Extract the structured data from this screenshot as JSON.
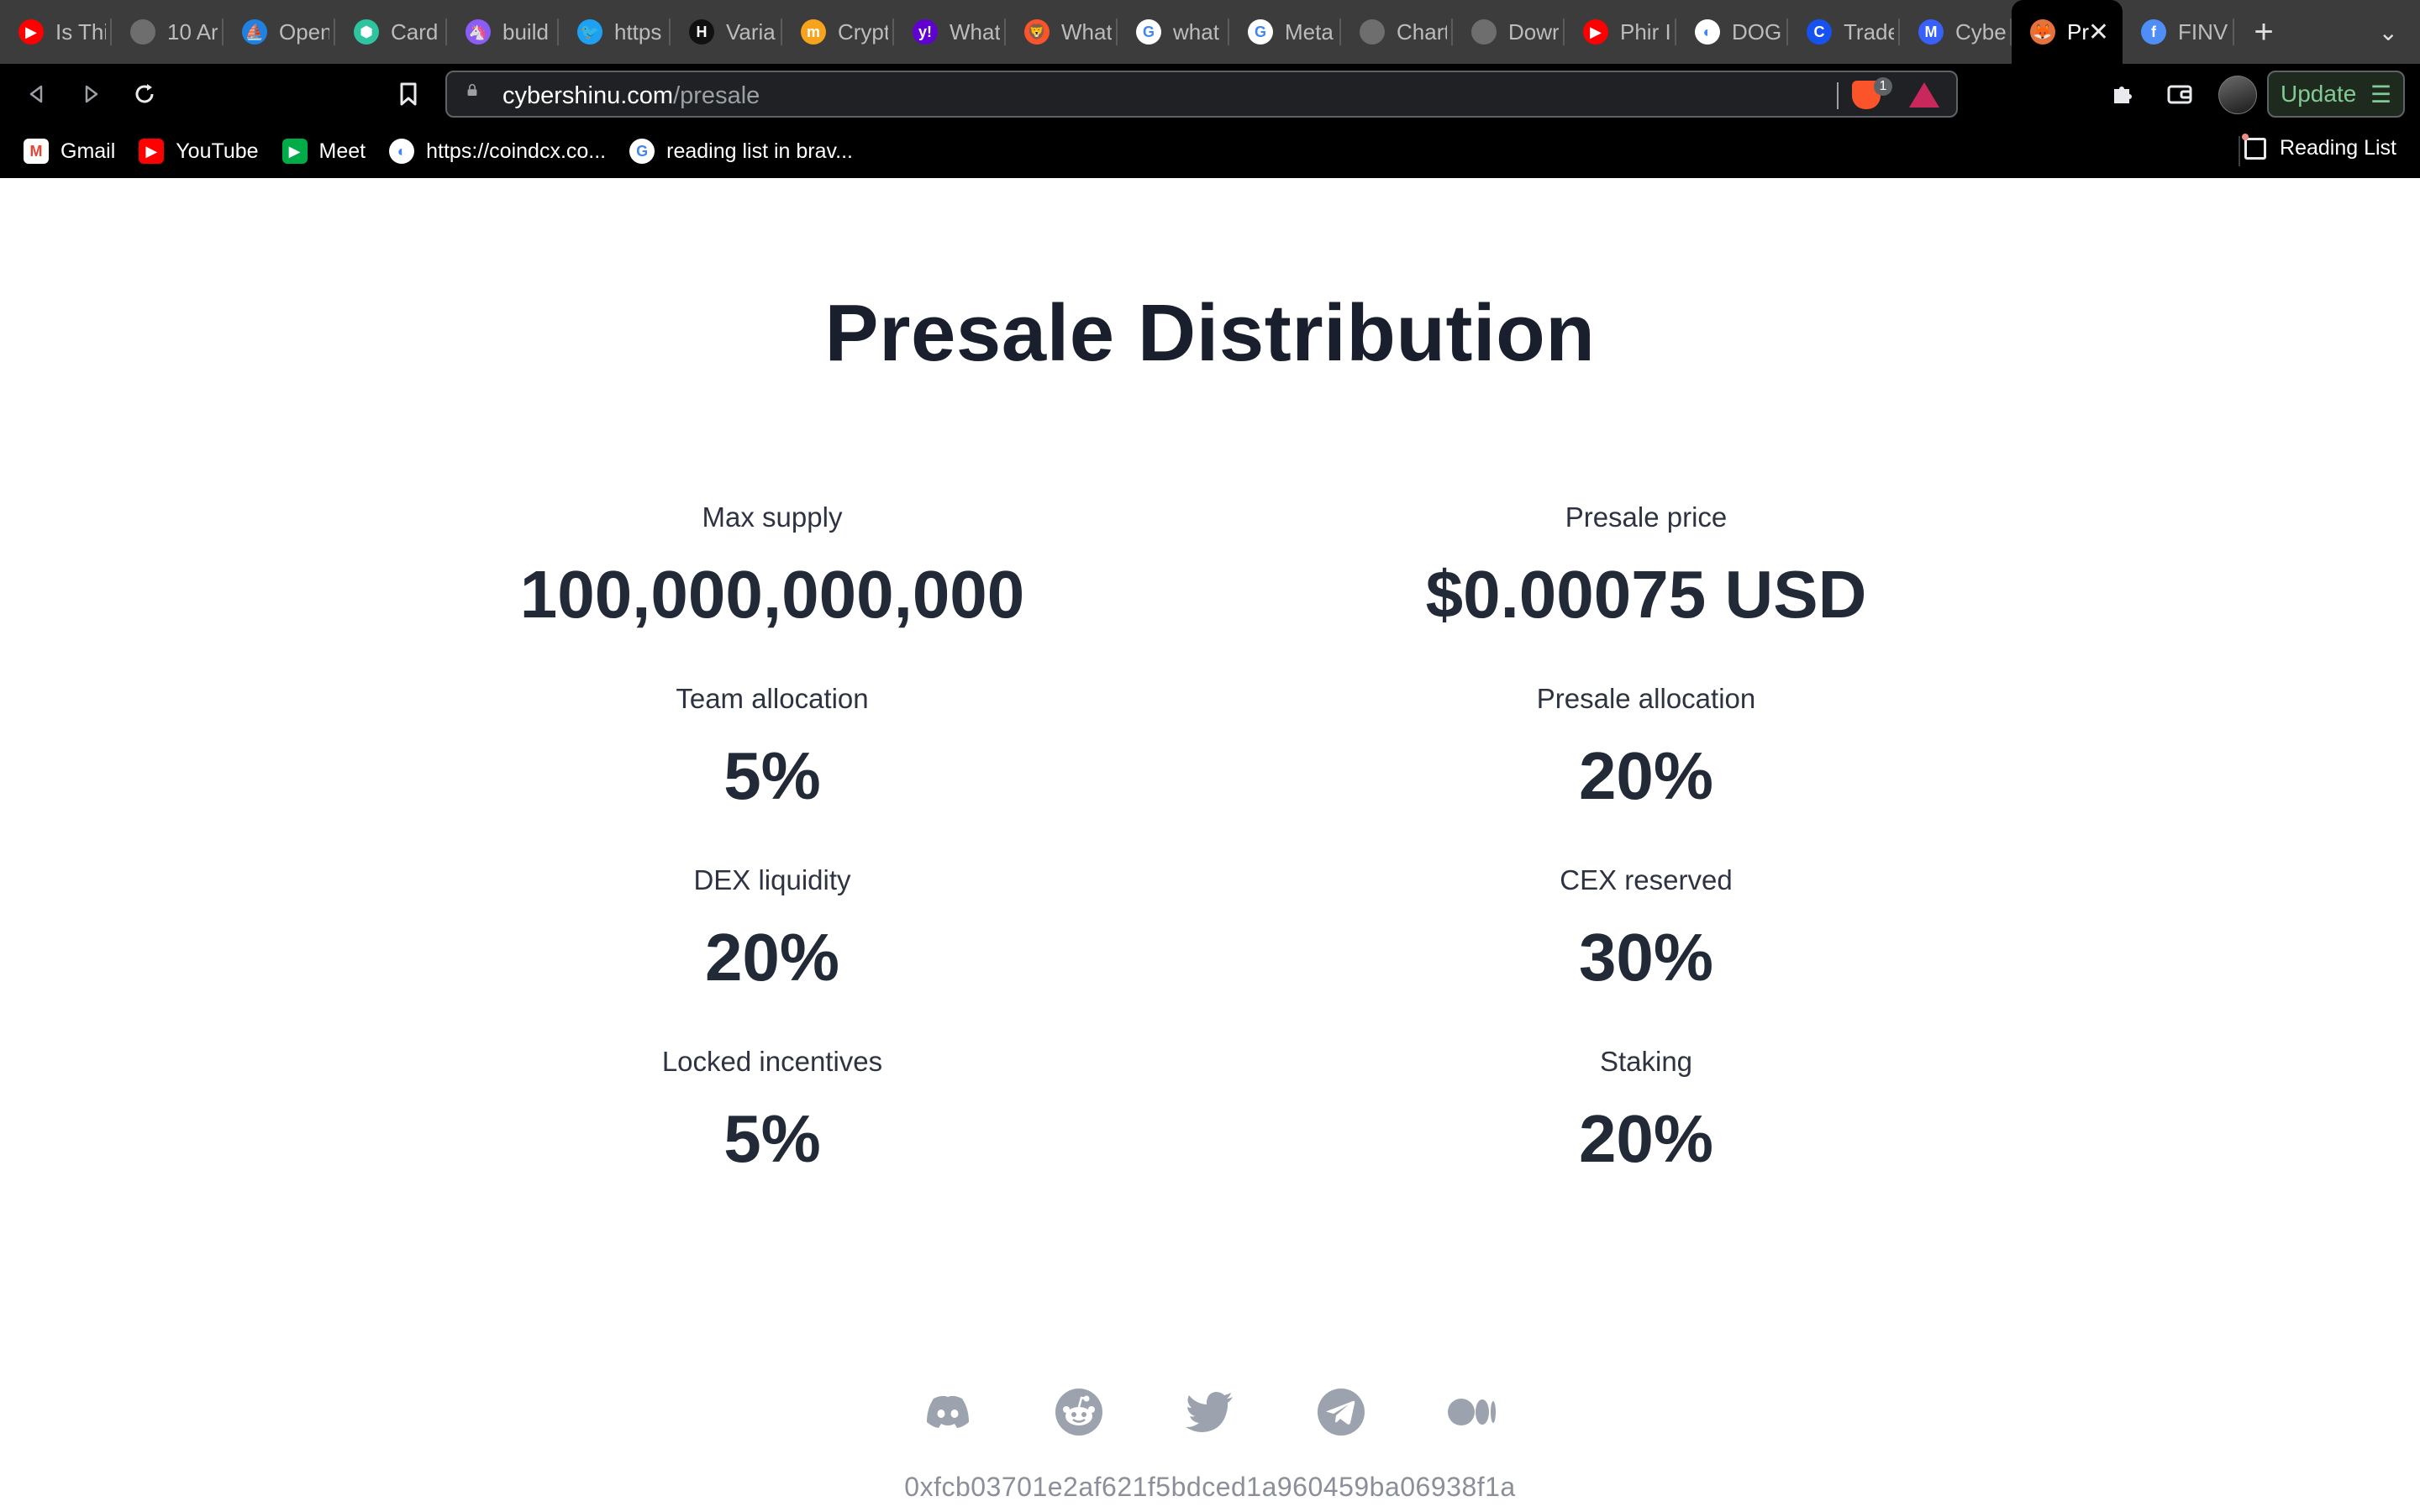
{
  "browser": {
    "tabs": [
      {
        "title": "Is Thi",
        "icon": "youtube-icon",
        "color": "#ff0000",
        "glyph": "▶"
      },
      {
        "title": "10 Ar",
        "icon": "globe-icon",
        "color": "#6e6e6e",
        "glyph": ""
      },
      {
        "title": "Open",
        "icon": "opensea-icon",
        "color": "#2081e2",
        "glyph": "⛵"
      },
      {
        "title": "Card",
        "icon": "cardano-icon",
        "color": "#2ec4a0",
        "glyph": "⬢"
      },
      {
        "title": "build",
        "icon": "unicorn-icon",
        "color": "#8b5cf6",
        "glyph": "🦄"
      },
      {
        "title": "https",
        "icon": "twitter-icon",
        "color": "#1da1f2",
        "glyph": "🐦"
      },
      {
        "title": "Varia",
        "icon": "variety-icon",
        "color": "#111111",
        "glyph": "H"
      },
      {
        "title": "Crypt",
        "icon": "coin-icon",
        "color": "#f7a31c",
        "glyph": "m"
      },
      {
        "title": "What",
        "icon": "yahoo-icon",
        "color": "#6001d2",
        "glyph": "y!"
      },
      {
        "title": "What",
        "icon": "brave-icon",
        "color": "#fb542b",
        "glyph": "🦁"
      },
      {
        "title": "what",
        "icon": "google-icon",
        "color": "#ffffff",
        "glyph": "G"
      },
      {
        "title": "Meta",
        "icon": "google-icon",
        "color": "#ffffff",
        "glyph": "G"
      },
      {
        "title": "Chart",
        "icon": "globe-icon",
        "color": "#6e6e6e",
        "glyph": ""
      },
      {
        "title": "Dowr",
        "icon": "globe-icon",
        "color": "#6e6e6e",
        "glyph": ""
      },
      {
        "title": "Phir I",
        "icon": "youtube-icon",
        "color": "#ff0000",
        "glyph": "▶"
      },
      {
        "title": "DOGE",
        "icon": "coindcx-icon",
        "color": "#ffffff",
        "glyph": "◐"
      },
      {
        "title": "Trade",
        "icon": "coinbase-icon",
        "color": "#1652f0",
        "glyph": "C"
      },
      {
        "title": "Cybe",
        "icon": "coinmarketcap-icon",
        "color": "#3861fb",
        "glyph": "M"
      },
      {
        "title": "Pr",
        "icon": "shiba-icon",
        "color": "#e8703a",
        "glyph": "🦊",
        "active": true
      },
      {
        "title": "FINV",
        "icon": "finv-icon",
        "color": "#4f8ef7",
        "glyph": "f"
      }
    ],
    "url_host": "cybershinu.com",
    "url_path": "/presale",
    "shield_count": "1",
    "update_label": "Update",
    "bookmarks": [
      {
        "label": "Gmail",
        "icon": "gmail-icon",
        "color": "#ea4335",
        "glyph": "M"
      },
      {
        "label": "YouTube",
        "icon": "youtube-icon",
        "color": "#ff0000",
        "glyph": "▶"
      },
      {
        "label": "Meet",
        "icon": "meet-icon",
        "color": "#00ac47",
        "glyph": "▶"
      },
      {
        "label": "https://coindcx.co...",
        "icon": "coindcx-icon",
        "color": "#ffffff",
        "glyph": "◐"
      },
      {
        "label": "reading list in brav...",
        "icon": "google-icon",
        "color": "#ffffff",
        "glyph": "G"
      }
    ],
    "reading_list_label": "Reading List"
  },
  "page": {
    "title": "Presale Distribution",
    "stats_left": [
      {
        "label": "Max supply",
        "value": "100,000,000,000"
      },
      {
        "label": "Team allocation",
        "value": "5%"
      },
      {
        "label": "DEX liquidity",
        "value": "20%"
      },
      {
        "label": "Locked incentives",
        "value": "5%"
      }
    ],
    "stats_right": [
      {
        "label": "Presale price",
        "value": "$0.00075 USD"
      },
      {
        "label": "Presale allocation",
        "value": "20%"
      },
      {
        "label": "CEX reserved",
        "value": "30%"
      },
      {
        "label": "Staking",
        "value": "20%"
      }
    ],
    "socials": [
      "discord-icon",
      "reddit-icon",
      "twitter-icon",
      "telegram-icon",
      "medium-icon"
    ],
    "contract_address": "0xfcb03701e2af621f5bdced1a960459ba06938f1a"
  },
  "colors": {
    "heading": "#1a1f2e",
    "label": "#2d3340",
    "value": "#222937",
    "social_icon": "#9ca3af",
    "address": "#8b8f99"
  }
}
